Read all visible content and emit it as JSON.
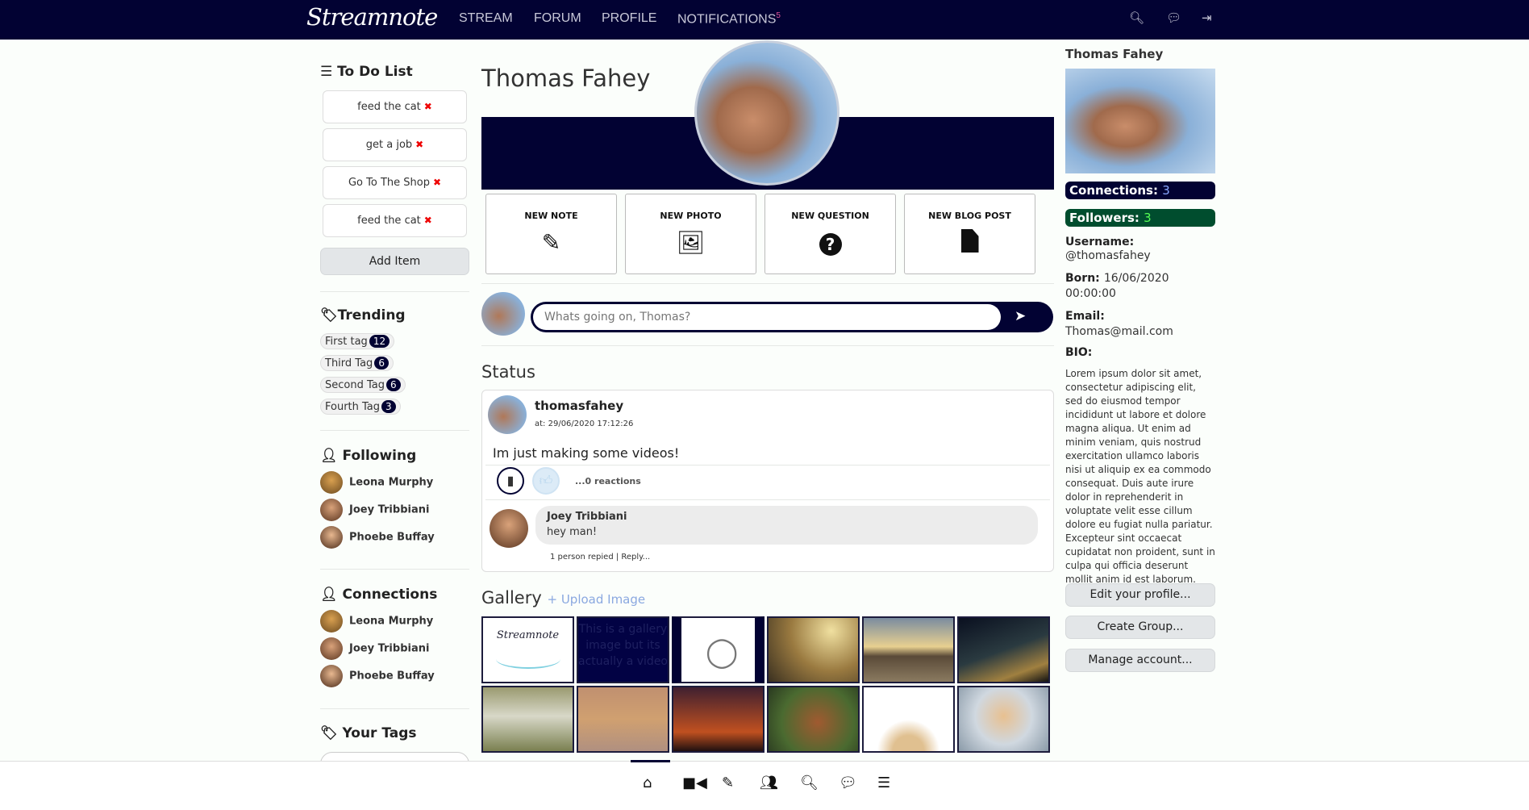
{
  "nav": {
    "logo": "Streamnote",
    "links": [
      "STREAM",
      "FORUM",
      "PROFILE",
      "NOTIFICATIONS"
    ],
    "notification_count": "5",
    "icons": [
      "search-icon",
      "chat-icon",
      "logout-icon"
    ]
  },
  "todo": {
    "title": "To Do List",
    "items": [
      "feed the cat",
      "get a job",
      "Go To The Shop",
      "feed the cat"
    ],
    "add_label": "Add Item"
  },
  "trending": {
    "title": "Trending",
    "tags": [
      {
        "name": "First tag",
        "count": "12"
      },
      {
        "name": "Third Tag",
        "count": "6"
      },
      {
        "name": "Second Tag",
        "count": "6"
      },
      {
        "name": "Fourth Tag",
        "count": "3"
      }
    ]
  },
  "following": {
    "title": "Following",
    "people": [
      "Leona Murphy",
      "Joey Tribbiani",
      "Phoebe Buffay"
    ]
  },
  "connections": {
    "title": "Connections",
    "people": [
      "Leona Murphy",
      "Joey Tribbiani",
      "Phoebe Buffay"
    ]
  },
  "your_tags": {
    "title": "Your Tags"
  },
  "profile": {
    "name": "Thomas Fahey"
  },
  "actions": [
    "NEW NOTE",
    "NEW PHOTO",
    "NEW QUESTION",
    "NEW BLOG POST"
  ],
  "composer": {
    "placeholder": "Whats going on, Thomas?"
  },
  "status": {
    "title": "Status",
    "post": {
      "user": "thomasfahey",
      "time": "at: 29/06/2020 17:12:26",
      "text": "Im just making some videos!",
      "reactions": "...0 reactions",
      "comment": {
        "user": "Joey Tribbiani",
        "text": "hey man!",
        "replies": "1 person repied",
        "reply": "Reply..."
      }
    }
  },
  "gallery": {
    "title": "Gallery",
    "upload": "+ Upload Image",
    "logo_text": "Streamnote",
    "broken_alt": "This is a gallery image but its actually a video"
  },
  "sidebar_right": {
    "name": "Thomas Fahey",
    "connections_label": "Connections:",
    "connections": "3",
    "followers_label": "Followers:",
    "followers": "3",
    "username_label": "Username:",
    "username": "@thomasfahey",
    "born_label": "Born:",
    "born": "16/06/2020 00:00:00",
    "email_label": "Email:",
    "email": "Thomas@mail.com",
    "bio_label": "BIO:",
    "bio": "Lorem ipsum dolor sit amet, consectetur adipiscing elit, sed do eiusmod tempor incididunt ut labore et dolore magna aliqua. Ut enim ad minim veniam, quis nostrud exercitation ullamco laboris nisi ut aliquip ex ea commodo consequat. Duis aute irure dolor in reprehenderit in voluptate velit esse cillum dolore eu fugiat nulla pariatur. Excepteur sint occaecat cupidatat non proident, sunt in culpa qui officia deserunt mollit anim id est laborum.",
    "buttons": [
      "Edit your profile...",
      "Create Group...",
      "Manage account..."
    ]
  },
  "colors": {
    "nav": "#020233",
    "followers": "#004d2e",
    "accent_pink": "#e0559a"
  }
}
